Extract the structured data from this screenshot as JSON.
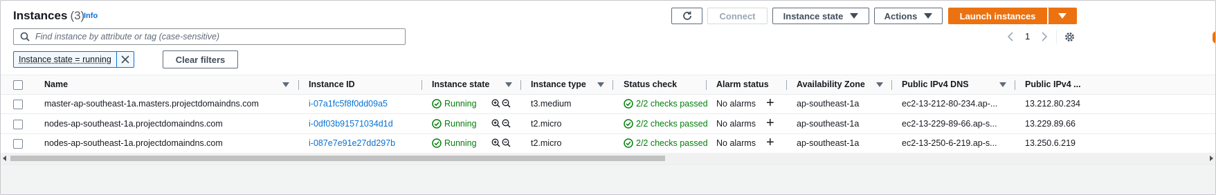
{
  "header": {
    "title": "Instances",
    "count": "(3)",
    "info": "Info"
  },
  "actions": {
    "refresh_icon": "refresh-icon",
    "connect": "Connect",
    "instance_state": "Instance state",
    "actions": "Actions",
    "launch": "Launch instances"
  },
  "search": {
    "placeholder": "Find instance by attribute or tag (case-sensitive)",
    "value": ""
  },
  "pagination": {
    "page": "1"
  },
  "filter": {
    "token": "Instance state = running",
    "clear": "Clear filters"
  },
  "columns": [
    "Name",
    "Instance ID",
    "Instance state",
    "Instance type",
    "Status check",
    "Alarm status",
    "Availability Zone",
    "Public IPv4 DNS",
    "Public IPv4 ..."
  ],
  "rows": [
    {
      "name": "master-ap-southeast-1a.masters.projectdomaindns.com",
      "id": "i-07a1fc5f8f0dd09a5",
      "state": "Running",
      "type": "t3.medium",
      "check": "2/2 checks passed",
      "alarm": "No alarms",
      "az": "ap-southeast-1a",
      "dns": "ec2-13-212-80-234.ap-...",
      "ip": "13.212.80.234"
    },
    {
      "name": "nodes-ap-southeast-1a.projectdomaindns.com",
      "id": "i-0df03b91571034d1d",
      "state": "Running",
      "type": "t2.micro",
      "check": "2/2 checks passed",
      "alarm": "No alarms",
      "az": "ap-southeast-1a",
      "dns": "ec2-13-229-89-66.ap-s...",
      "ip": "13.229.89.66"
    },
    {
      "name": "nodes-ap-southeast-1a.projectdomaindns.com",
      "id": "i-087e7e91e27dd297b",
      "state": "Running",
      "type": "t2.micro",
      "check": "2/2 checks passed",
      "alarm": "No alarms",
      "az": "ap-southeast-1a",
      "dns": "ec2-13-250-6-219.ap-s...",
      "ip": "13.250.6.219"
    }
  ],
  "colors": {
    "accent": "#ec7211",
    "link": "#0972d3",
    "success": "#037f0c"
  }
}
